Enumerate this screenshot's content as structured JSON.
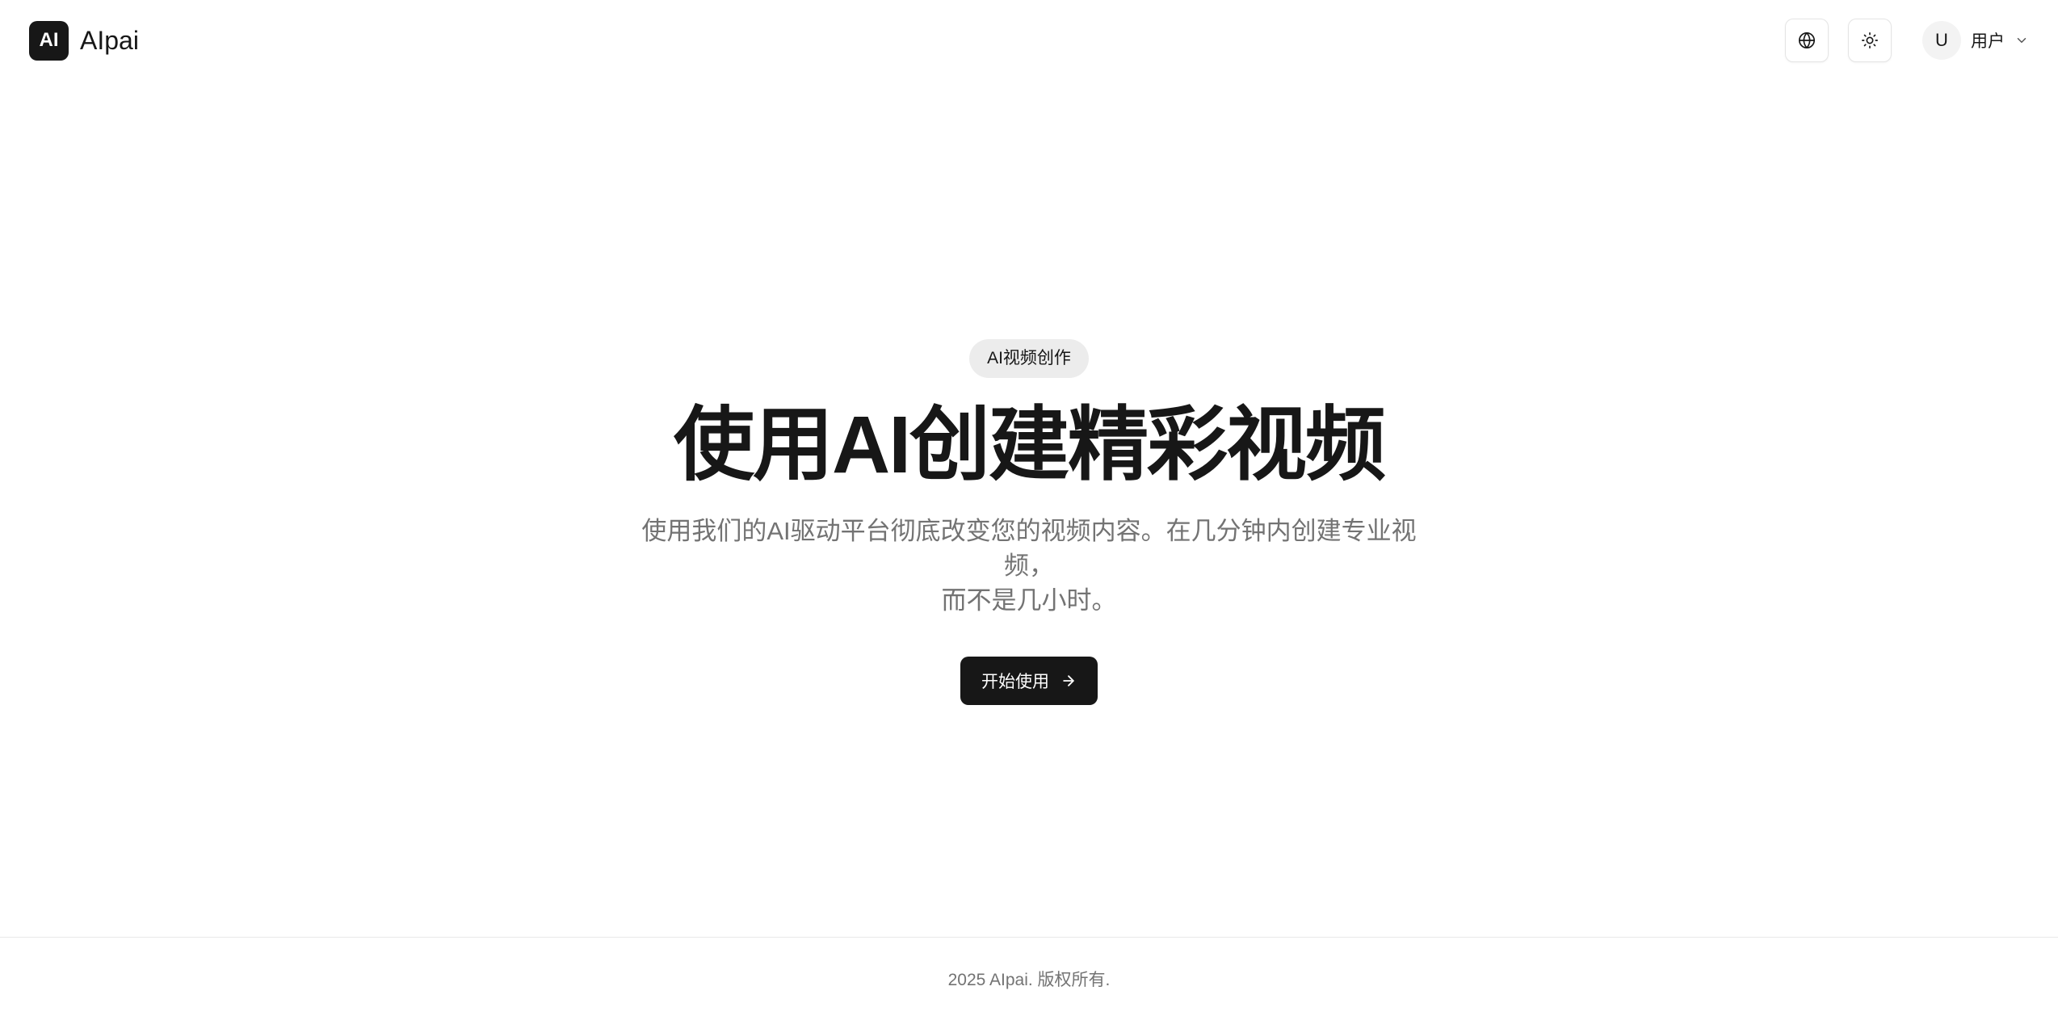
{
  "header": {
    "logo_text": "AI",
    "brand_name": "AIpai",
    "language_button_icon": "globe-icon",
    "theme_button_icon": "sun-icon",
    "user": {
      "avatar_initial": "U",
      "name": "用户",
      "menu_icon": "chevron-down-icon"
    }
  },
  "hero": {
    "badge": "AI视频创作",
    "title": "使用AI创建精彩视频",
    "subtitle_line1": "使用我们的AI驱动平台彻底改变您的视频内容。在几分钟内创建专业视频，",
    "subtitle_line2": "而不是几小时。",
    "cta_label": "开始使用",
    "cta_icon": "arrow-right-icon"
  },
  "footer": {
    "copyright": "2025 AIpai. 版权所有."
  },
  "colors": {
    "primary": "#171717",
    "muted_text": "#737373",
    "badge_bg": "#ececec",
    "border": "#e5e5e5",
    "background": "#ffffff"
  }
}
